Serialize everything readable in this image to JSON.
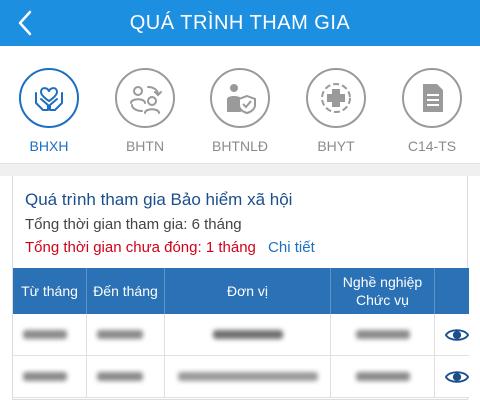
{
  "header": {
    "title": "QUÁ TRÌNH THAM GIA",
    "back_icon": "chevron-left-icon"
  },
  "tabs": [
    {
      "label": "BHXH",
      "icon": "hands-heart-icon",
      "active": true
    },
    {
      "label": "BHTN",
      "icon": "people-exchange-icon",
      "active": false
    },
    {
      "label": "BHTNLĐ",
      "icon": "worker-shield-icon",
      "active": false
    },
    {
      "label": "BHYT",
      "icon": "medical-cross-icon",
      "active": false
    },
    {
      "label": "C14-TS",
      "icon": "document-icon",
      "active": false
    }
  ],
  "summary": {
    "title": "Quá trình tham gia Bảo hiểm xã hội",
    "total_time": "Tổng thời gian tham gia: 6 tháng",
    "unpaid_time": "Tổng thời gian chưa đóng: 1 tháng",
    "detail_link": "Chi tiết"
  },
  "table": {
    "headers": {
      "from_month": "Từ tháng",
      "to_month": "Đến tháng",
      "unit": "Đơn vị",
      "job_line1": "Nghề nghiệp",
      "job_line2": "Chức vụ"
    },
    "rows": [
      {
        "from": "",
        "to": "",
        "unit": "",
        "job": ""
      },
      {
        "from": "",
        "to": "",
        "unit": "",
        "job": ""
      }
    ]
  },
  "colors": {
    "header": "#1d8fe1",
    "accent": "#1d6fc2",
    "table_header": "#2b71b5",
    "warning": "#d0021b"
  }
}
